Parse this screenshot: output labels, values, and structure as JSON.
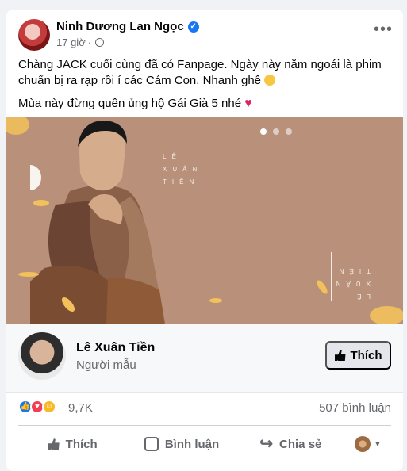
{
  "post": {
    "author": "Ninh Dương Lan Ngọc",
    "time": "17 giờ",
    "text1": "Chàng JACK cuối cùng đã có Fanpage. Ngày này năm ngoái là phim chuẩn bị ra rạp rồi í các Cám Con. Nhanh ghê",
    "text2": "Mùa này đừng quên ủng hộ Gái Già 5 nhé",
    "icons": [
      "verified-icon",
      "globe-icon",
      "more-icon",
      "heart-icon"
    ]
  },
  "hero": {
    "text_top": "LÊ XUÂN TIẾN",
    "text_bottom": "LÊ XUÂN TIẾN",
    "colors": {
      "background": "#b9917b",
      "accent": "#f2c15b"
    }
  },
  "page": {
    "name": "Lê Xuân Tiền",
    "role": "Người mẫu",
    "like_label": "Thích"
  },
  "stats": {
    "reaction_count": "9,7K",
    "comment_count": "507 bình luận"
  },
  "actions": {
    "like": "Thích",
    "comment": "Bình luận",
    "share": "Chia sẻ"
  }
}
